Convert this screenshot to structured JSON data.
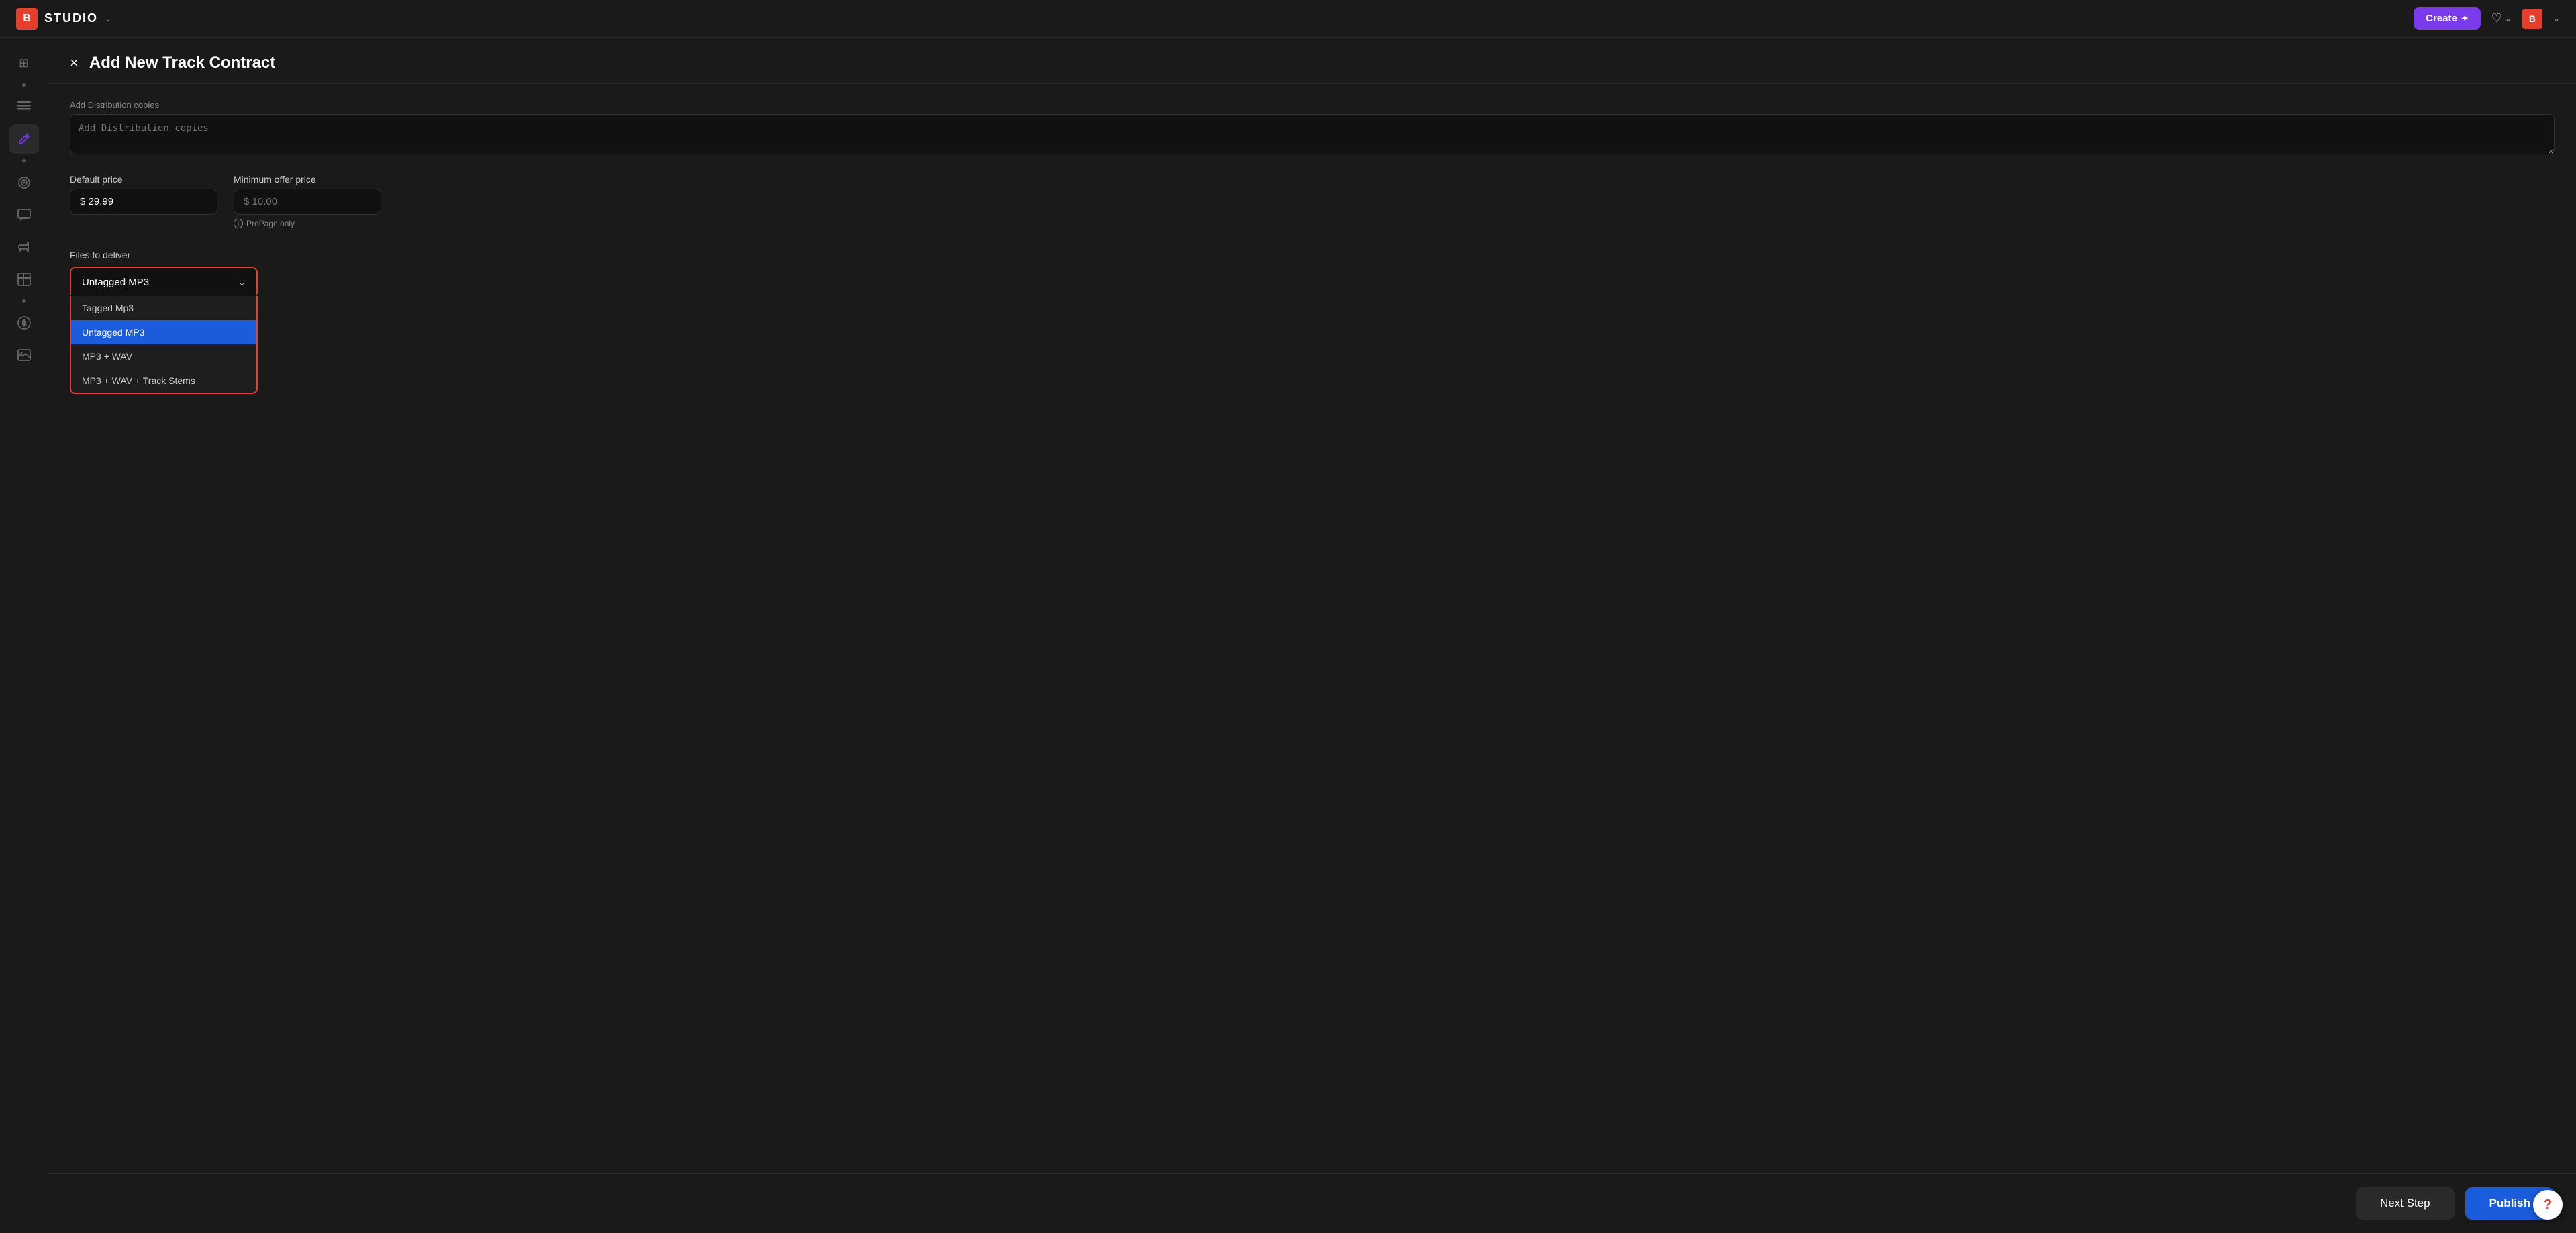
{
  "navbar": {
    "logo_text": "B",
    "studio_label": "STUDIO",
    "create_button": "Create",
    "sparkle_icon": "✦"
  },
  "sidebar": {
    "items": [
      {
        "icon": "⊞",
        "label": "grid-icon",
        "active": false
      },
      {
        "dot": true
      },
      {
        "icon": "⊟",
        "label": "bars-icon",
        "active": false
      },
      {
        "icon": "✎",
        "label": "edit-icon",
        "active": true
      },
      {
        "dot": true
      },
      {
        "icon": "◎",
        "label": "circle-icon",
        "active": false
      },
      {
        "icon": "⊡",
        "label": "box-icon",
        "active": false
      },
      {
        "icon": "◫",
        "label": "layout-icon",
        "active": false
      },
      {
        "dot": true
      },
      {
        "icon": "$",
        "label": "dollar-icon",
        "active": false
      },
      {
        "icon": "⊟",
        "label": "image-icon",
        "active": false
      }
    ]
  },
  "dialog": {
    "title": "Add New Track Contract",
    "close_icon": "×",
    "textarea_label": "Add Distribution copies",
    "textarea_placeholder": "Add Distribution copies",
    "default_price_label": "Default price",
    "default_price_value": "$ 29.99",
    "minimum_price_label": "Minimum offer price",
    "minimum_price_placeholder": "$ 10.00",
    "propage_note": "ProPage only",
    "deliver_label": "Files to deliver",
    "dropdown_selected": "Untagged MP3",
    "dropdown_options": [
      {
        "label": "Tagged Mp3",
        "selected": false
      },
      {
        "label": "Untagged MP3",
        "selected": true
      },
      {
        "label": "MP3 + WAV",
        "selected": false
      },
      {
        "label": "MP3 + WAV + Track Stems",
        "selected": false
      }
    ]
  },
  "footer": {
    "next_step_label": "Next Step",
    "publish_label": "Publish"
  },
  "help_btn_label": "?"
}
